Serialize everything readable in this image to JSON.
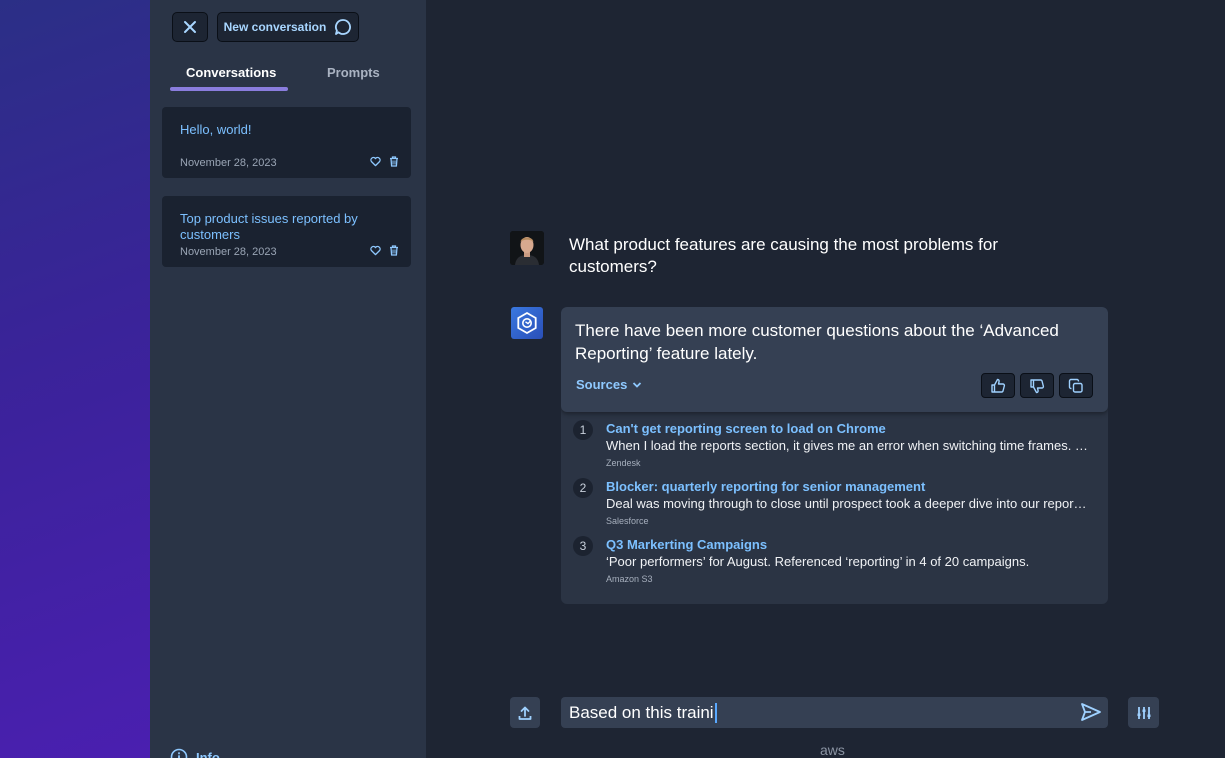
{
  "sidebar": {
    "new_conversation_label": "New conversation",
    "tabs": [
      {
        "label": "Conversations",
        "active": true
      },
      {
        "label": "Prompts",
        "active": false
      }
    ],
    "conversations": [
      {
        "title": "Hello, world!",
        "date": "November 28, 2023"
      },
      {
        "title": "Top product issues reported by customers",
        "date": "November 28, 2023"
      }
    ],
    "info_label": "Info"
  },
  "chat": {
    "user_message": "What product features are causing the most problems for customers?",
    "assistant_message": "There have been more customer questions about the ‘Advanced Reporting’ feature lately.",
    "sources_label": "Sources",
    "sources": [
      {
        "num": "1",
        "title": "Can't get reporting screen to load on Chrome",
        "snippet": "When I load the reports section, it gives me an error when switching time frames. …",
        "origin": "Zendesk"
      },
      {
        "num": "2",
        "title": "Blocker: quarterly reporting for senior management",
        "snippet": "Deal was moving through to close until prospect took a deeper dive into our repor…",
        "origin": "Salesforce"
      },
      {
        "num": "3",
        "title": "Q3 Markerting Campaigns",
        "snippet": "‘Poor performers’ for August. Referenced ‘reporting’ in 4 of 20 campaigns.",
        "origin": "Amazon S3"
      }
    ]
  },
  "composer": {
    "input_value": "Based on this traini"
  },
  "footer": {
    "brand": "aws"
  },
  "icons": {
    "close": "close-icon",
    "new_conversation": "chat-bubble-icon",
    "favorite": "heart-icon",
    "delete": "trash-icon",
    "info": "info-icon",
    "thumbs_up": "thumbs-up-icon",
    "thumbs_down": "thumbs-down-icon",
    "copy": "copy-icon",
    "upload": "upload-icon",
    "send": "send-icon",
    "settings": "sliders-icon",
    "chevron": "chevron-down-icon"
  },
  "colors": {
    "accent_link": "#7cc0ff",
    "tab_underline": "#8a7dde",
    "sidebar_bg": "#2a3446",
    "main_bg": "#1e2533"
  }
}
